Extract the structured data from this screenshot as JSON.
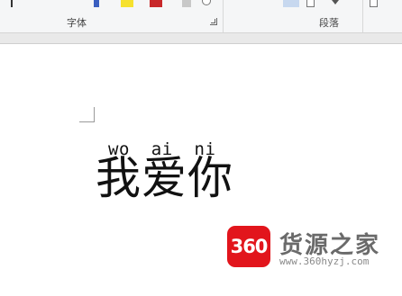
{
  "ribbon": {
    "font_group_label": "字体",
    "paragraph_group_label": "段落"
  },
  "document": {
    "pinyin": "wo  ai  ni",
    "hanzi": "我爱你"
  },
  "watermark": {
    "logo_text": "360",
    "title": "货源之家",
    "url": "www.360hyzj.com"
  }
}
